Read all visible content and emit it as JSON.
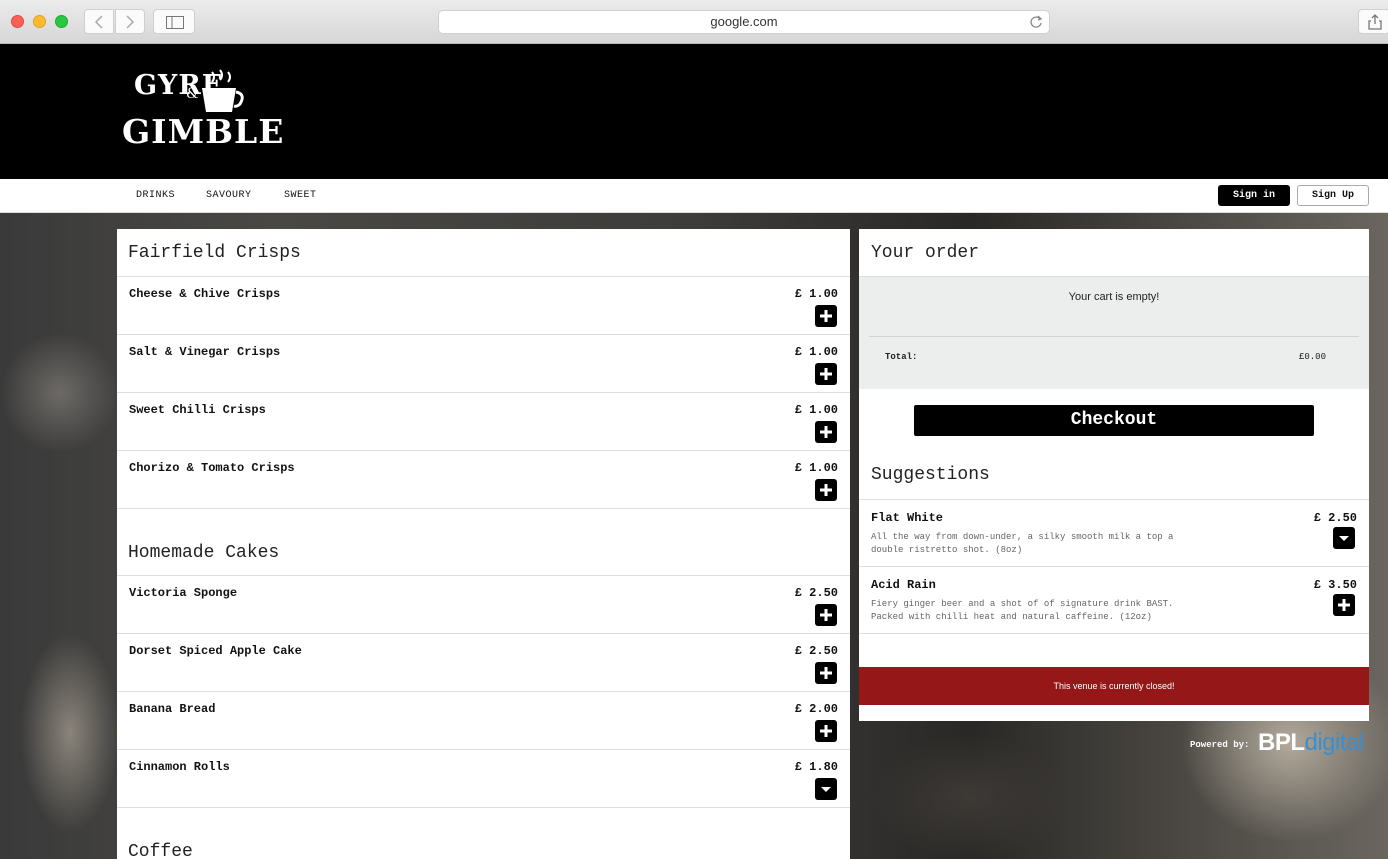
{
  "browser": {
    "url": "google.com"
  },
  "site": {
    "logo_line1": "GYRE",
    "logo_amp": "&",
    "logo_line2": "GIMBLE"
  },
  "nav": {
    "links": [
      "DRINKS",
      "SAVOURY",
      "SWEET"
    ],
    "signin_label": "Sign in",
    "signup_label": "Sign Up"
  },
  "menu": {
    "sections": [
      {
        "title": "Fairfield Crisps",
        "items": [
          {
            "name": "Cheese & Chive Crisps",
            "price": "£ 1.00"
          },
          {
            "name": "Salt & Vinegar Crisps",
            "price": "£ 1.00"
          },
          {
            "name": "Sweet Chilli Crisps",
            "price": "£ 1.00"
          },
          {
            "name": "Chorizo & Tomato Crisps",
            "price": "£ 1.00"
          }
        ]
      },
      {
        "title": "Homemade Cakes",
        "items": [
          {
            "name": "Victoria Sponge",
            "price": "£ 2.50"
          },
          {
            "name": "Dorset Spiced Apple Cake",
            "price": "£ 2.50"
          },
          {
            "name": "Banana Bread",
            "price": "£ 2.00"
          },
          {
            "name": "Cinnamon Rolls",
            "price": "£ 1.80"
          }
        ]
      },
      {
        "title": "Coffee",
        "items": []
      }
    ]
  },
  "order": {
    "title": "Your order",
    "empty_text": "Your cart is empty!",
    "total_label": "Total:",
    "total_value": "£0.00",
    "checkout_label": "Checkout",
    "suggestions_title": "Suggestions",
    "suggestions": [
      {
        "name": "Flat White",
        "price": "£ 2.50",
        "desc": "All the way from down-under, a silky smooth milk a top a double ristretto shot. (8oz)"
      },
      {
        "name": "Acid Rain",
        "price": "£ 3.50",
        "desc": "Fiery ginger beer and a shot of of signature drink BAST. Packed with chilli heat and natural caffeine. (12oz)"
      }
    ],
    "closed_text": "This venue is currently closed!"
  },
  "footer": {
    "powered_by": "Powered by:",
    "brand_bpl": "BPL",
    "brand_digital": "digital"
  },
  "colors": {
    "closed_bar": "#951717",
    "brand_digital": "#3a8fd1"
  }
}
